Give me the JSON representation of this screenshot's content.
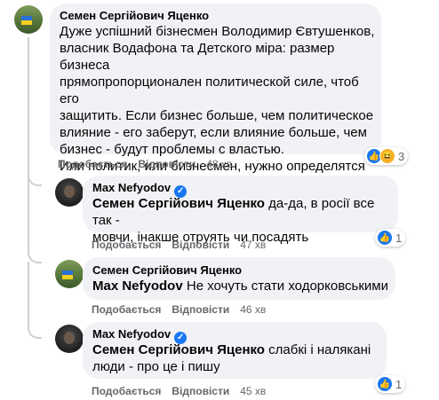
{
  "comments": [
    {
      "author": "Семен Сергійович Яценко",
      "text": "Дуже успішний бізнесмен Володимир Євтушенков,\nвласник Водафона та Детского міра: размер бизнеса\nпрямопропорционален политической силе, чтоб его\nзащитить. Если бизнес больше, чем политическое\nвлияние - его заберут, если влияние больше, чем\nбизнес - будут проблемы с властью.\nИли политик, или бизнесмен, нужно определятся",
      "like": "Подобається",
      "reply": "Відповісти",
      "time": "48 хв",
      "reactions_count": "3",
      "reaction_icons": [
        "like-icon",
        "haha-icon"
      ]
    },
    {
      "author": "Max Nefyodov",
      "verified": true,
      "mention": "Семен Сергійович Яценко",
      "text": " да-да, в росії все так -\nмовчи, інакше отруять чи посадять",
      "like": "Подобається",
      "reply": "Відповісти",
      "time": "47 хв",
      "reactions_count": "1"
    },
    {
      "author": "Семен Сергійович Яценко",
      "mention": "Max Nefyodov",
      "text": " Не хочуть стати ходорковськими",
      "like": "Подобається",
      "reply": "Відповісти",
      "time": "46 хв"
    },
    {
      "author": "Max Nefyodov",
      "verified": true,
      "mention": "Семен Сергійович Яценко",
      "text": " слабкі і налякані\nлюди - про це і пишу",
      "like": "Подобається",
      "reply": "Відповісти",
      "time": "45 хв",
      "reactions_count": "1"
    }
  ],
  "colors": {
    "bubble": "#f0f2f5",
    "meta": "#65676b",
    "like_blue": "#1877f2",
    "haha_yellow": "#f7b125"
  }
}
